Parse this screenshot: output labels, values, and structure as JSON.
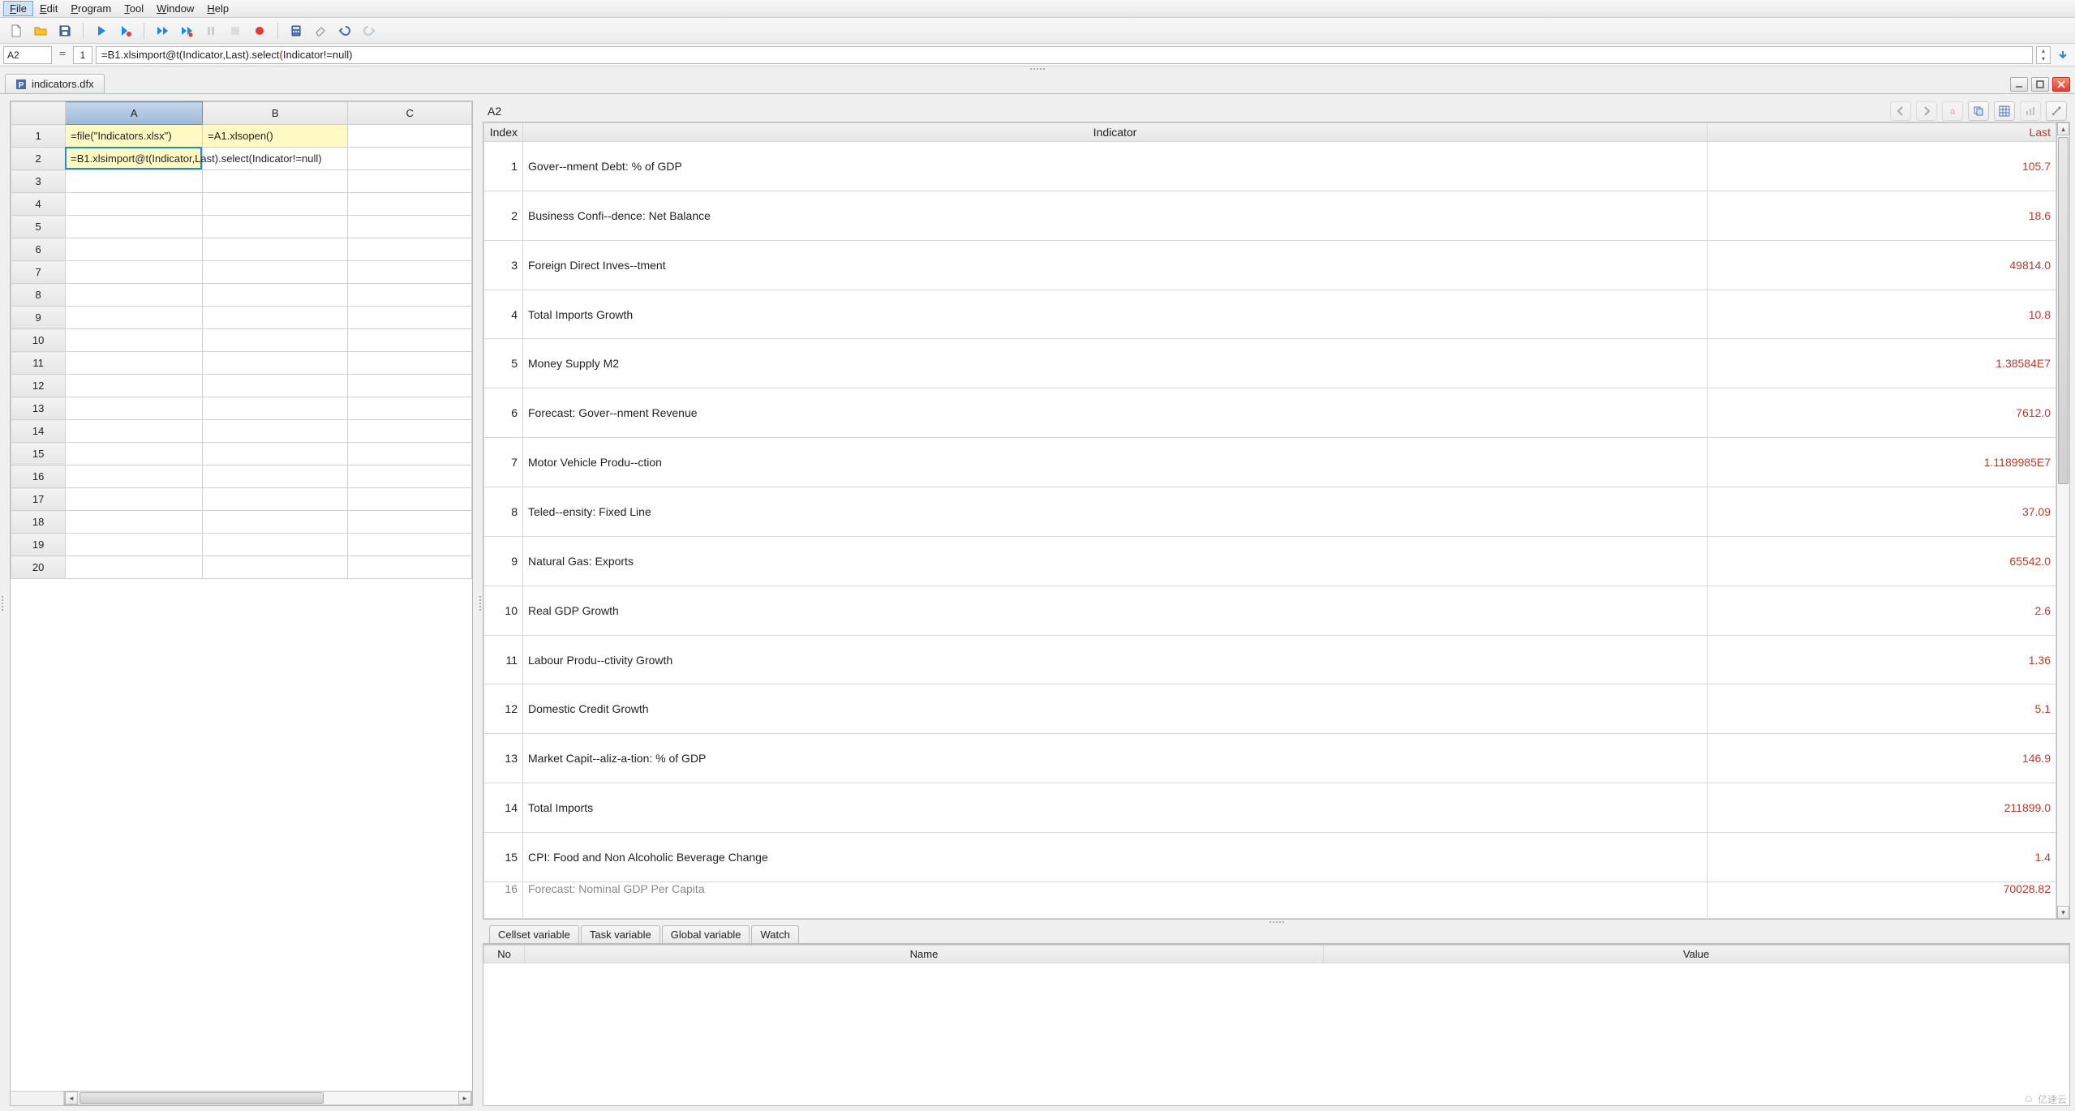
{
  "menu": {
    "file": {
      "label": "File",
      "u": "F"
    },
    "edit": {
      "label": "Edit",
      "u": "E"
    },
    "program": {
      "label": "Program",
      "u": "P"
    },
    "tool": {
      "label": "Tool",
      "u": "T"
    },
    "window": {
      "label": "Window",
      "u": "W"
    },
    "help": {
      "label": "Help",
      "u": "H"
    }
  },
  "formulabar": {
    "cellref": "A2",
    "eq": "=",
    "lineno": "1",
    "formula_prefix": "=B1.xlsimport@t(Indicator,Last).select",
    "formula_paren": "(",
    "formula_suffix": "Indicator!=null)"
  },
  "tab": {
    "doc_name": "indicators.dfx"
  },
  "sheet": {
    "cols": [
      "A",
      "B",
      "C"
    ],
    "rows": 20,
    "cells": {
      "A1": "=file(\"Indicators.xlsx\")",
      "B1": "=A1.xlsopen()",
      "A2": "=B1.xlsimport@t(Indicator,Last).select(Indicator!=null)"
    },
    "selected": "A2"
  },
  "result": {
    "title": "A2",
    "headers": {
      "index": "Index",
      "indicator": "Indicator",
      "last": "Last"
    },
    "rows": [
      {
        "i": "1",
        "ind": "Gover--nment Debt: % of GDP",
        "last": "105.7"
      },
      {
        "i": "2",
        "ind": "Business Confi--dence: Net Balance",
        "last": "18.6"
      },
      {
        "i": "3",
        "ind": "Foreign Direct Inves--tment",
        "last": "49814.0"
      },
      {
        "i": "4",
        "ind": "Total Imports Growth",
        "last": "10.8"
      },
      {
        "i": "5",
        "ind": "Money Supply M2",
        "last": "1.38584E7"
      },
      {
        "i": "6",
        "ind": "Forecast: Gover--nment Revenue",
        "last": "7612.0"
      },
      {
        "i": "7",
        "ind": "Motor Vehicle Produ--ction",
        "last": "1.1189985E7"
      },
      {
        "i": "8",
        "ind": "Teled--ensity: Fixed Line",
        "last": "37.09"
      },
      {
        "i": "9",
        "ind": "Natural Gas: Exports",
        "last": "65542.0"
      },
      {
        "i": "10",
        "ind": "Real GDP Growth",
        "last": "2.6"
      },
      {
        "i": "11",
        "ind": "Labour Produ--ctivity Growth",
        "last": "1.36"
      },
      {
        "i": "12",
        "ind": "Domestic Credit Growth",
        "last": "5.1"
      },
      {
        "i": "13",
        "ind": "Market Capit--aliz-a-tion: % of GDP",
        "last": "146.9"
      },
      {
        "i": "14",
        "ind": "Total Imports",
        "last": "211899.0"
      },
      {
        "i": "15",
        "ind": "CPI: Food and Non Alcoholic Beverage Change",
        "last": "1.4"
      }
    ],
    "partial": {
      "i": "16",
      "ind": "Forecast: Nominal GDP Per Capita",
      "last": "70028.82"
    }
  },
  "bottom_tabs": {
    "cellset": "Cellset variable",
    "task": "Task variable",
    "global": "Global variable",
    "watch": "Watch"
  },
  "var_table": {
    "headers": {
      "no": "No",
      "name": "Name",
      "value": "Value"
    }
  },
  "watermark": "亿速云"
}
